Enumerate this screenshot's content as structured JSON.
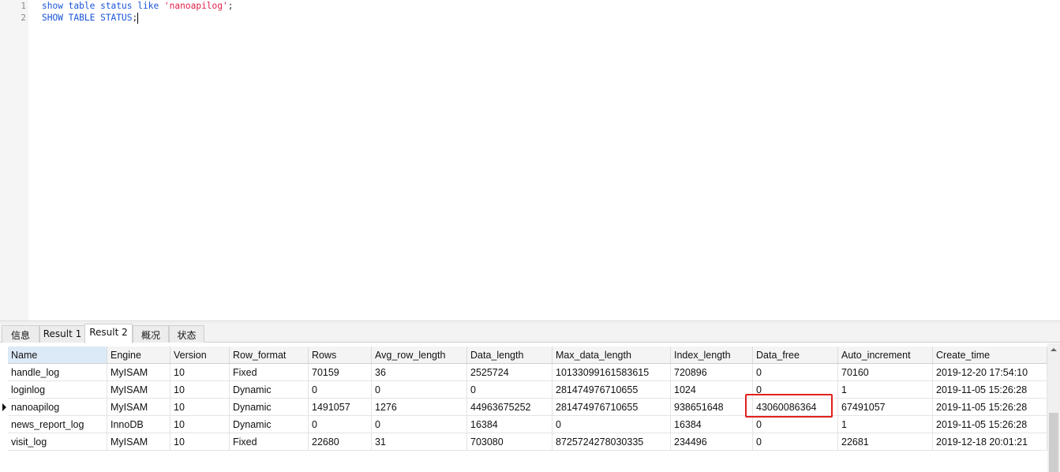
{
  "editor": {
    "lines": [
      {
        "no": "1",
        "kw": "show table status like ",
        "str": "'nanoapilog'",
        "end": ";"
      },
      {
        "no": "2",
        "kw": "SHOW TABLE STATUS",
        "str": "",
        "end": ";"
      }
    ]
  },
  "tabs": [
    "信息",
    "Result 1",
    "Result 2",
    "概况",
    "状态"
  ],
  "active_tab": "Result 2",
  "grid": {
    "columns": [
      "Name",
      "Engine",
      "Version",
      "Row_format",
      "Rows",
      "Avg_row_length",
      "Data_length",
      "Max_data_length",
      "Index_length",
      "Data_free",
      "Auto_increment",
      "Create_time"
    ],
    "rows": [
      [
        "handle_log",
        "MyISAM",
        "10",
        "Fixed",
        "70159",
        "36",
        "2525724",
        "10133099161583615",
        "720896",
        "0",
        "70160",
        "2019-12-20 17:54:10"
      ],
      [
        "loginlog",
        "MyISAM",
        "10",
        "Dynamic",
        "0",
        "0",
        "0",
        "281474976710655",
        "1024",
        "0",
        "1",
        "2019-11-05 15:26:28"
      ],
      [
        "nanoapilog",
        "MyISAM",
        "10",
        "Dynamic",
        "1491057",
        "1276",
        "44963675252",
        "281474976710655",
        "938651648",
        "43060086364",
        "67491057",
        "2019-11-05 15:26:28"
      ],
      [
        "news_report_log",
        "InnoDB",
        "10",
        "Dynamic",
        "0",
        "0",
        "16384",
        "0",
        "16384",
        "0",
        "1",
        "2019-11-05 15:26:28"
      ],
      [
        "visit_log",
        "MyISAM",
        "10",
        "Fixed",
        "22680",
        "31",
        "703080",
        "8725724278030335",
        "234496",
        "0",
        "22681",
        "2019-12-18 20:01:21"
      ]
    ],
    "current_row": 2,
    "highlight_color": "#e0201e"
  }
}
